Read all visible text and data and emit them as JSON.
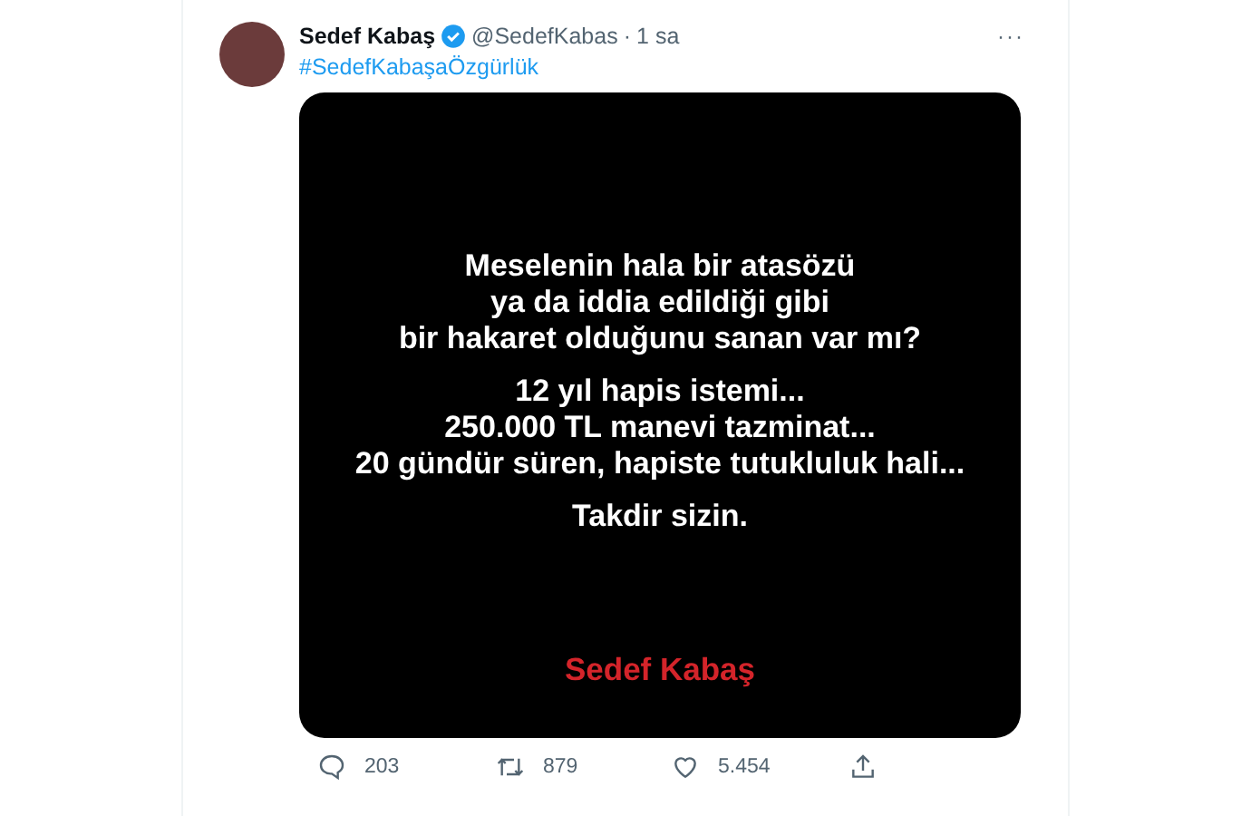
{
  "tweet": {
    "author_name": "Sedef Kabaş",
    "verified": true,
    "handle": "@SedefKabas",
    "separator": "·",
    "time": "1 sa",
    "more": "···",
    "hashtag": "#SedefKabaşaÖzgürlük"
  },
  "media": {
    "paragraphs": [
      [
        "Meselenin hala bir atasözü",
        "ya da iddia edildiği gibi",
        "bir hakaret olduğunu sanan var mı?"
      ],
      [
        "12 yıl hapis istemi...",
        "250.000 TL manevi tazminat...",
        "20 gündür süren, hapiste tutukluluk hali..."
      ],
      [
        "Takdir sizin."
      ]
    ],
    "signature": "Sedef Kabaş"
  },
  "actions": [
    {
      "kind": "reply",
      "count": "203"
    },
    {
      "kind": "retweet",
      "count": "879"
    },
    {
      "kind": "like",
      "count": "5.454"
    },
    {
      "kind": "share"
    }
  ]
}
